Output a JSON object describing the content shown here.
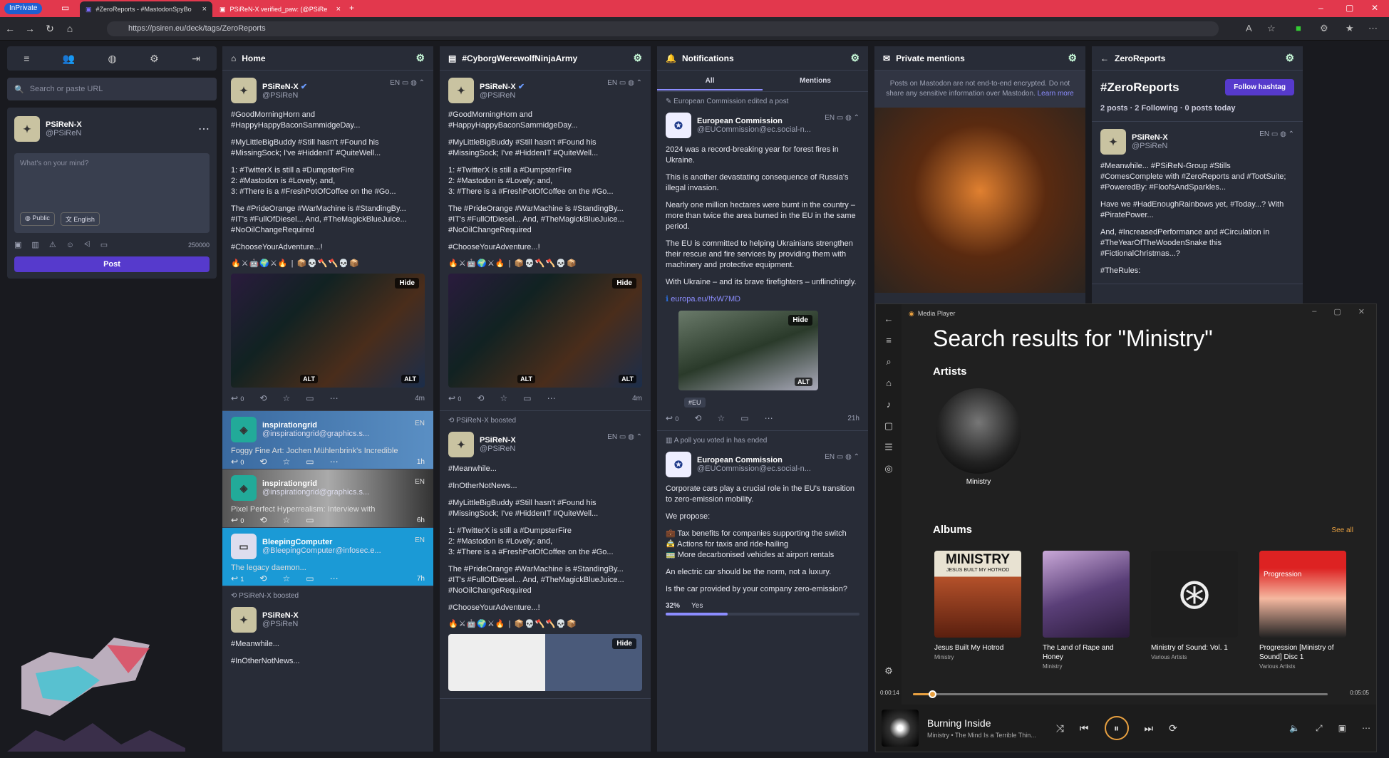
{
  "browser": {
    "inprivate": "InPrivate",
    "tabs": [
      {
        "label": "#ZeroReports - #MastodonSpyBo"
      },
      {
        "label": "PSiReN-X verified_paw: (@PSiRe"
      }
    ],
    "url": "https://psiren.eu/deck/tags/ZeroReports"
  },
  "sidebar": {
    "search_placeholder": "Search or paste URL",
    "user_name": "PSiReN-X",
    "user_handle": "@PSiReN",
    "compose_placeholder": "What's on your mind?",
    "visibility": "Public",
    "language": "English",
    "char_count": "250000",
    "post_label": "Post"
  },
  "columns": {
    "home": {
      "title": "Home"
    },
    "list": {
      "title": "#CyborgWerewolfNinjaArmy"
    },
    "notifications": {
      "title": "Notifications",
      "tab_all": "All",
      "tab_mentions": "Mentions"
    },
    "mentions": {
      "title": "Private mentions",
      "notice": "Posts on Mastodon are not end-to-end encrypted. Do not share any sensitive information over Mastodon.",
      "learn_more": "Learn more"
    },
    "hashtag": {
      "title": "ZeroReports",
      "tag": "#ZeroReports",
      "follow": "Follow hashtag",
      "stats": "2 posts · 2 Following · 0 posts today"
    }
  },
  "post": {
    "name": "PSiReN-X",
    "handle": "@PSiReN",
    "lang": "EN",
    "time": "4m",
    "p1": "#GoodMorningHorn and #HappyHappyBaconSammidgeDay...",
    "p2": "#MyLittleBigBuddy #Still hasn't #Found his #MissingSock; I've #HiddenIT #QuiteWell...",
    "p3a": "1: #TwitterX is still a #DumpsterFire",
    "p3b": "2: #Mastodon is #Lovely; and,",
    "p3c": "3: #There is a #FreshPotOfCoffee on the #Go...",
    "p4": "The #PrideOrange #WarMachine is #StandingBy... #IT's #FullOfDiesel... And, #TheMagickBlueJuice... #NoOilChangeRequired",
    "p5": "#ChooseYourAdventure...!",
    "hide": "Hide",
    "alt": "ALT",
    "reply_count": "0"
  },
  "home_extra": [
    {
      "name": "inspirationgrid",
      "handle": "@inspirationgrid@graphics.s...",
      "text": "Foggy Fine Art: Jochen Mühlenbrink's Incredible",
      "lang": "EN",
      "time": "1h",
      "replies": "0"
    },
    {
      "name": "inspirationgrid",
      "handle": "@inspirationgrid@graphics.s...",
      "text": "Pixel Perfect Hyperrealism: Interview with",
      "lang": "EN",
      "time": "6h",
      "replies": "0"
    },
    {
      "name": "BleepingComputer",
      "handle": "@BleepingComputer@infosec.e...",
      "text": "The legacy daemon...",
      "lang": "EN",
      "time": "7h",
      "replies": "1"
    }
  ],
  "boosted": {
    "who": "PSiReN-X",
    "label": "boosted",
    "p_meanwhile": "#Meanwhile...",
    "p_inother": "#InOtherNotNews..."
  },
  "notif": {
    "edited": "European Commission edited a post",
    "name": "European Commission",
    "handle": "@EUCommission@ec.social-n...",
    "p1": "2024 was a record-breaking year for forest fires in Ukraine.",
    "p2": "This is another devastating consequence of Russia's illegal invasion.",
    "p3": "Nearly one million hectares were burnt in the country – more than twice the area burned in the EU in the same period.",
    "p4": "The EU is committed to helping Ukrainians strengthen their rescue and fire services by providing them with machinery and protective equipment.",
    "p5": "With Ukraine – and its brave firefighters – unflinchingly.",
    "link": "europa.eu/!fxW7MD",
    "hashtag": "#EU",
    "time": "21h",
    "poll_ended": "A poll you voted in has ended",
    "q1": "Corporate cars play a crucial role in the EU's transition to zero-emission mobility.",
    "q2": "We propose:",
    "q3": "💼 Tax benefits for companies supporting the switch",
    "q4": "🚖 Actions for taxis and ride-hailing",
    "q5": "🚃 More decarbonised vehicles at airport rentals",
    "q6": "An electric car should be the norm, not a luxury.",
    "q7": "Is the car provided by your company zero-emission?",
    "poll_pct": "32%",
    "poll_opt": "Yes",
    "poll_fill": 0.32
  },
  "hashpost": {
    "p1": "#Meanwhile... #PSiReN-Group #Stills #ComesComplete with #ZeroReports and #TootSuite; #PoweredBy: #FloofsAndSparkles...",
    "p2": "Have we #HadEnoughRainbows yet, #Today...? With #PiratePower...",
    "p3": "And, #IncreasedPerformance and #Circulation in #TheYearOfTheWoodenSnake this #FictionalChristmas...?",
    "p4": "#TheRules:"
  },
  "mediaplayer": {
    "app": "Media Player",
    "heading": "Search results for \"Ministry\"",
    "artists_label": "Artists",
    "artist": "Ministry",
    "albums_label": "Albums",
    "see_all": "See all",
    "albums": [
      {
        "title": "Jesus Built My Hotrod",
        "artist": "Ministry",
        "cover_text": "MINISTRY",
        "cover_sub": "JESUS BUILT MY HOTROD"
      },
      {
        "title": "The Land of Rape and Honey",
        "artist": "Ministry"
      },
      {
        "title": "Ministry of Sound: Vol. 1",
        "artist": "Various Artists"
      },
      {
        "title": "Progression [Ministry of Sound] Disc 1",
        "artist": "Various Artists",
        "cover_text": "Progression"
      }
    ],
    "time_elapsed": "0:00:14",
    "time_total": "0:05:05",
    "progress": 0.046,
    "track": "Burning Inside",
    "track_sub": "Ministry • The Mind Is a Terrible Thin..."
  }
}
